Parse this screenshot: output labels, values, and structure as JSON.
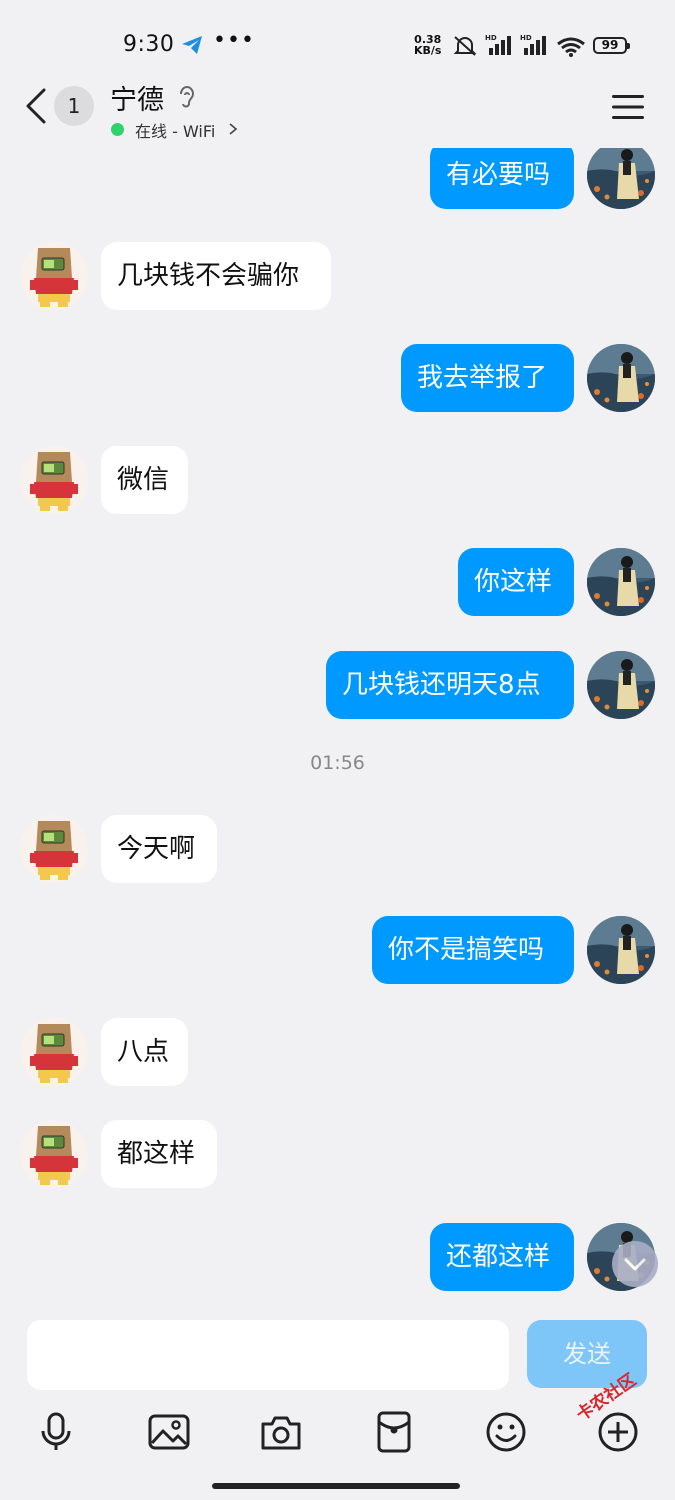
{
  "status_bar": {
    "time": "9:30",
    "net_speed_value": "0.38",
    "net_speed_unit": "KB/s",
    "battery": "99"
  },
  "header": {
    "unread_count": "1",
    "contact_name": "宁德",
    "online_status": "在线 - WiFi"
  },
  "messages": [
    {
      "side": "right",
      "text": "有必要吗"
    },
    {
      "side": "left",
      "text": "几块钱不会骗你"
    },
    {
      "side": "right",
      "text": "我去举报了"
    },
    {
      "side": "left",
      "text": "微信"
    },
    {
      "side": "right",
      "text": "你这样"
    },
    {
      "side": "right",
      "text": "几块钱还明天8点"
    },
    {
      "side": "left",
      "text": "今天啊"
    },
    {
      "side": "right",
      "text": "你不是搞笑吗"
    },
    {
      "side": "left",
      "text": "八点"
    },
    {
      "side": "left",
      "text": "都这样"
    },
    {
      "side": "right",
      "text": "还都这样"
    }
  ],
  "timestamp": "01:56",
  "input": {
    "send_label": "发送"
  },
  "watermark": "卡农社区",
  "colors": {
    "accent": "#0099ff",
    "background": "#f1f1f3",
    "online": "#2fd26b"
  }
}
